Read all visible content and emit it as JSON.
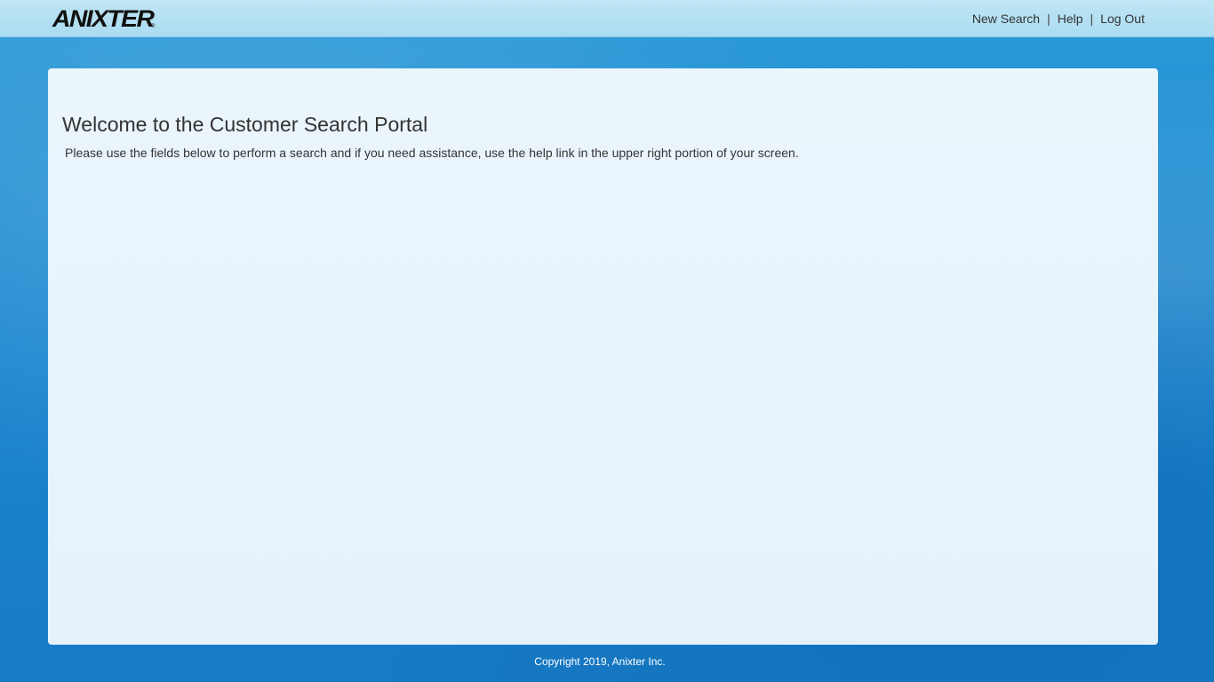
{
  "header": {
    "logo_text": "ANIXTER",
    "logo_mark": "®",
    "nav": {
      "new_search": "New Search",
      "help": "Help",
      "log_out": "Log Out",
      "separator": "|"
    }
  },
  "main": {
    "title": "Welcome to the Customer Search Portal",
    "intro": "Please use the fields below to perform a search and if you need assistance, use the help link in the upper right portion of your screen."
  },
  "footer": {
    "copyright": "Copyright 2019, Anixter Inc."
  },
  "colors": {
    "background": "#1a86cf",
    "header": "#b6e1f3",
    "panel": "#e8f4fb",
    "text": "#333333"
  }
}
